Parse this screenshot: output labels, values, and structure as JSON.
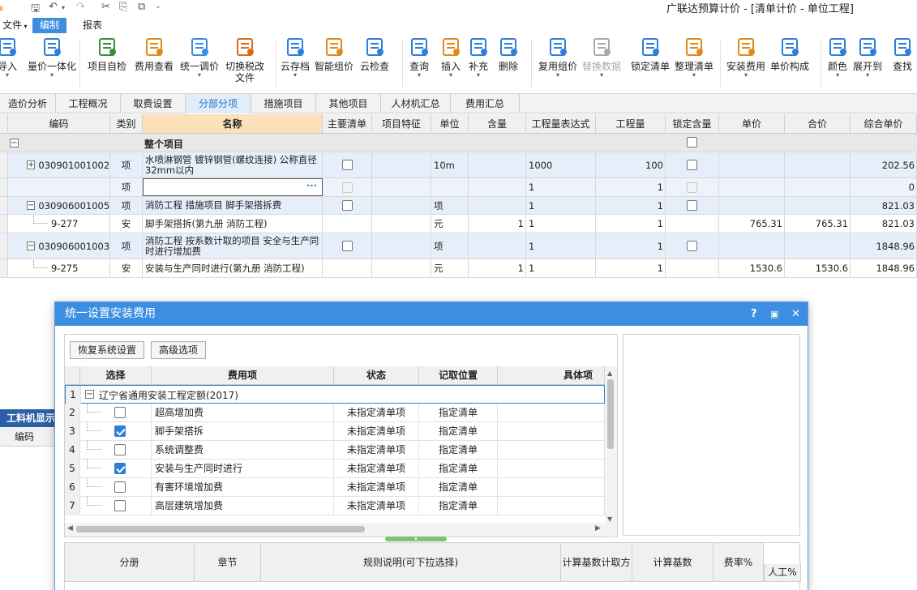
{
  "app": {
    "title": "广联达预算计价 - [清单计价 - 单位工程]"
  },
  "menu": [
    "文件",
    "编制",
    "报表"
  ],
  "ribbon": [
    {
      "label": "导入",
      "arrow": true,
      "icon": "import-icon"
    },
    {
      "label": "量价一体化",
      "arrow": true,
      "icon": "quantity-price-icon"
    },
    {
      "label": "项目自检",
      "icon": "project-check-icon"
    },
    {
      "label": "费用查看",
      "icon": "fee-view-icon"
    },
    {
      "label": "统一调价",
      "arrow": true,
      "icon": "unified-price-icon"
    },
    {
      "label": "切换税改\n文件",
      "icon": "tax-switch-icon"
    },
    {
      "label": "云存档",
      "arrow": true,
      "icon": "cloud-save-icon"
    },
    {
      "label": "智能组价",
      "icon": "smart-price-icon"
    },
    {
      "label": "云检查",
      "icon": "cloud-check-icon"
    },
    {
      "label": "查询",
      "arrow": true,
      "icon": "query-icon"
    },
    {
      "label": "插入",
      "arrow": true,
      "icon": "insert-icon"
    },
    {
      "label": "补充",
      "arrow": true,
      "icon": "supplement-icon"
    },
    {
      "label": "删除",
      "icon": "delete-icon"
    },
    {
      "label": "复用组价",
      "arrow": true,
      "icon": "reuse-price-icon"
    },
    {
      "label": "替换数据",
      "arrow": true,
      "icon": "replace-data-icon",
      "disabled": true
    },
    {
      "label": "锁定清单",
      "icon": "lock-list-icon"
    },
    {
      "label": "整理清单",
      "arrow": true,
      "icon": "organize-list-icon"
    },
    {
      "label": "安装费用",
      "arrow": true,
      "icon": "install-fee-icon"
    },
    {
      "label": "单价构成",
      "icon": "unit-price-icon"
    },
    {
      "label": "颜色",
      "arrow": true,
      "icon": "color-icon"
    },
    {
      "label": "展开到",
      "arrow": true,
      "icon": "expand-icon"
    },
    {
      "label": "查找",
      "icon": "find-icon"
    }
  ],
  "tabs": [
    "造价分析",
    "工程概况",
    "取费设置",
    "分部分项",
    "措施项目",
    "其他项目",
    "人材机汇总",
    "费用汇总"
  ],
  "grid": {
    "headers": [
      "编码",
      "类别",
      "名称",
      "主要清单",
      "项目特征",
      "单位",
      "含量",
      "工程量表达式",
      "工程量",
      "锁定含量",
      "单价",
      "合价",
      "综合单价"
    ],
    "group": "整个项目",
    "rows": [
      {
        "code": "030901001002",
        "type": "项",
        "name": "水喷淋钢管 镀锌钢管(螺纹连接) 公称直径32mm以内",
        "unit": "10m",
        "expr": "1000",
        "qty": "100",
        "comp": "202.56"
      },
      {
        "code": "",
        "type": "项",
        "name": "",
        "unit": "",
        "expr": "1",
        "qty": "1",
        "comp": "0",
        "edit_btn": "···"
      },
      {
        "code": "030906001005",
        "type": "项",
        "name": "消防工程 措施项目 脚手架搭拆费",
        "unit": "项",
        "expr": "1",
        "qty": "1",
        "comp": "821.03"
      },
      {
        "code": "9-277",
        "type": "安",
        "name": "脚手架搭拆(第九册 消防工程)",
        "unit": "元",
        "content": "1",
        "expr": "1",
        "qty": "1",
        "price": "765.31",
        "total": "765.31",
        "comp": "821.03"
      },
      {
        "code": "030906001003",
        "type": "项",
        "name": "消防工程 按系数计取的项目 安全与生产同时进行增加费",
        "unit": "项",
        "expr": "1",
        "qty": "1",
        "comp": "1848.96"
      },
      {
        "code": "9-275",
        "type": "安",
        "name": "安装与生产同时进行(第九册 消防工程)",
        "unit": "元",
        "content": "1",
        "expr": "1",
        "qty": "1",
        "price": "1530.6",
        "total": "1530.6",
        "comp": "1848.96"
      }
    ]
  },
  "bottom_panel": {
    "title": "工料机显示",
    "col": "编码"
  },
  "dialog": {
    "title": "统一设置安装费用",
    "buttons": [
      "恢复系统设置",
      "高级选项"
    ],
    "headers": [
      "选择",
      "费用项",
      "状态",
      "记取位置",
      "具体项"
    ],
    "group_label": "辽宁省通用安装工程定额(2017)",
    "rows": [
      {
        "n": "2",
        "checked": false,
        "name": "超高增加费",
        "status": "未指定清单项",
        "pos": "指定清单"
      },
      {
        "n": "3",
        "checked": true,
        "name": "脚手架搭拆",
        "status": "未指定清单项",
        "pos": "指定清单"
      },
      {
        "n": "4",
        "checked": false,
        "name": "系统调整费",
        "status": "未指定清单项",
        "pos": "指定清单"
      },
      {
        "n": "5",
        "checked": true,
        "name": "安装与生产同时进行",
        "status": "未指定清单项",
        "pos": "指定清单"
      },
      {
        "n": "6",
        "checked": false,
        "name": "有害环境增加费",
        "status": "未指定清单项",
        "pos": "指定清单"
      },
      {
        "n": "7",
        "checked": false,
        "name": "高层建筑增加费",
        "status": "未指定清单项",
        "pos": "指定清单"
      }
    ],
    "bottom_headers": [
      "分册",
      "章节",
      "规则说明(可下拉选择)",
      "计算基数计取方式",
      "计算基数",
      "费率%",
      "人工%"
    ]
  },
  "colors": {
    "accent": "#3c8ee0",
    "row_highlight": "#e6eefa",
    "selected_header": "#fbe0b9"
  }
}
